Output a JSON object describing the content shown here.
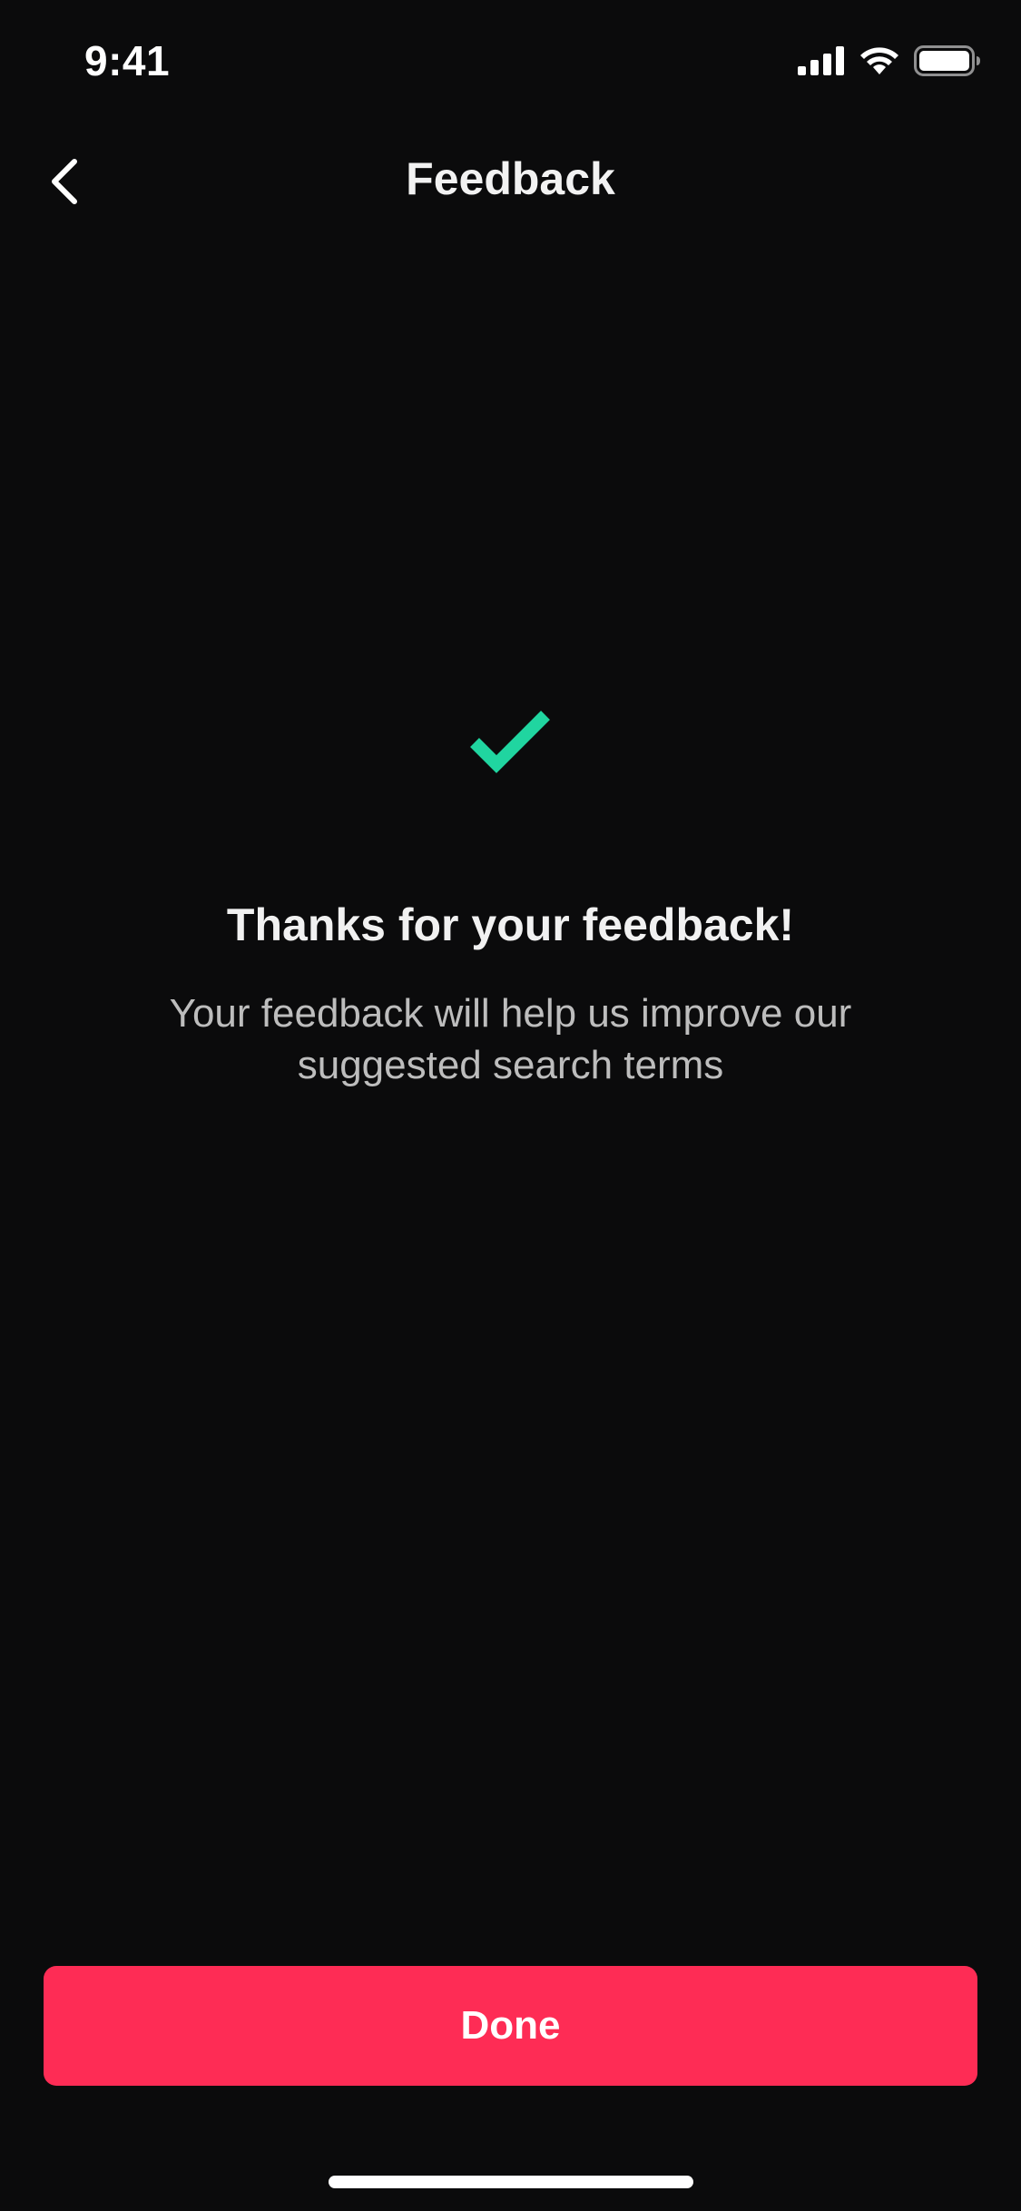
{
  "status_bar": {
    "time": "9:41",
    "icons": [
      "cellular-signal-icon",
      "wifi-icon",
      "battery-icon"
    ]
  },
  "header": {
    "title": "Feedback",
    "back_icon": "chevron-left-icon"
  },
  "confirmation": {
    "icon": "checkmark-icon",
    "title": "Thanks for your feedback!",
    "message": "Your feedback will help us improve our suggested search terms"
  },
  "footer": {
    "done_label": "Done"
  },
  "colors": {
    "background": "#0b0b0c",
    "accent": "#fe2c55",
    "success": "#20d5a0",
    "text_primary": "#f1f1f1",
    "text_secondary": "#bdbdbd"
  }
}
